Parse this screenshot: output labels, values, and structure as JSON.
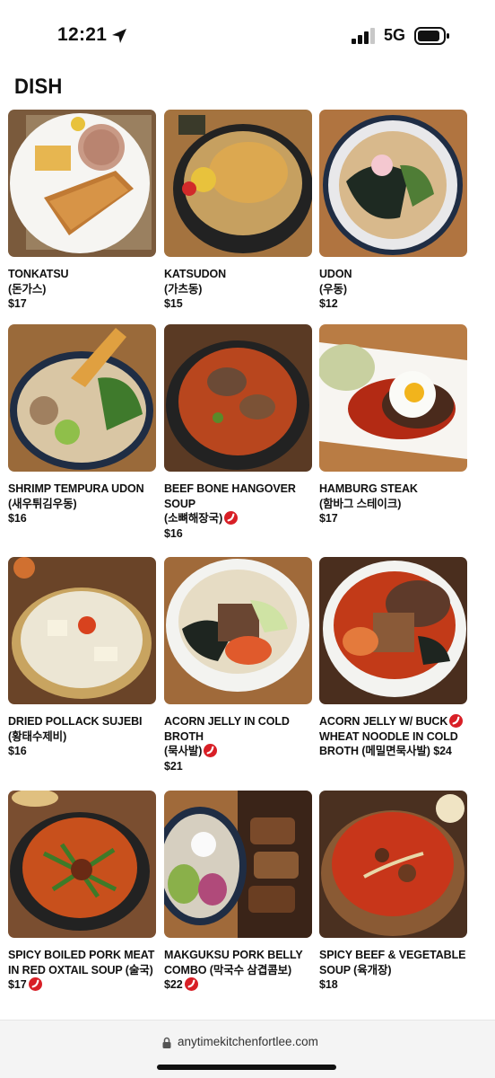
{
  "status_bar": {
    "time": "12:21",
    "network": "5G"
  },
  "section": {
    "title": "DISH"
  },
  "dishes": [
    {
      "name": "TONKATSU",
      "korean": "(돈가스)",
      "price": "$17",
      "spicy": false
    },
    {
      "name": "KATSUDON",
      "korean": "(가츠동)",
      "price": "$15",
      "spicy": false
    },
    {
      "name": "UDON",
      "korean": "(우동)",
      "price": "$12",
      "spicy": false
    },
    {
      "name": "SHRIMP TEMPURA UDON",
      "korean": "(새우튀김우동)",
      "price": "$16",
      "spicy": false
    },
    {
      "name": "BEEF BONE HANGOVER SOUP",
      "korean": "(소뼈해장국)",
      "price": "$16",
      "spicy": true
    },
    {
      "name": "HAMBURG STEAK",
      "korean": "(함바그 스테이크)",
      "price": "$17",
      "spicy": false
    },
    {
      "name": "DRIED POLLACK SUJEBI",
      "korean": "(황태수제비)",
      "price": "$16",
      "spicy": false
    },
    {
      "name": "ACORN JELLY IN COLD BROTH",
      "korean": "(묵사발)",
      "price": "$21",
      "spicy": true
    },
    {
      "name": "ACORN JELLY W/ BUCK",
      "korean": "WHEAT NOODLE IN COLD",
      "price": "BROTH (메밀면묵사발) $24",
      "spicy": true
    },
    {
      "name": "SPICY BOILED PORK MEAT",
      "korean": "IN RED OXTAIL SOUP (술국)",
      "price": "$17",
      "spicy": true
    },
    {
      "name": "MAKGUKSU PORK BELLY",
      "korean": "COMBO (막국수 삼겹콤보)",
      "price": "$22",
      "spicy": true
    },
    {
      "name": "SPICY BEEF & VEGETABLE",
      "korean": "SOUP (육개장)",
      "price": "$18",
      "spicy": false
    }
  ],
  "browser": {
    "url": "anytimekitchenfortlee.com"
  },
  "icons": {
    "location": "location-arrow-icon",
    "signal": "cellular-signal-icon",
    "battery": "battery-icon",
    "spicy": "chili-pepper-icon",
    "lock": "lock-icon"
  },
  "colors": {
    "spicy": "#d81f26",
    "price_text": "#111111"
  }
}
